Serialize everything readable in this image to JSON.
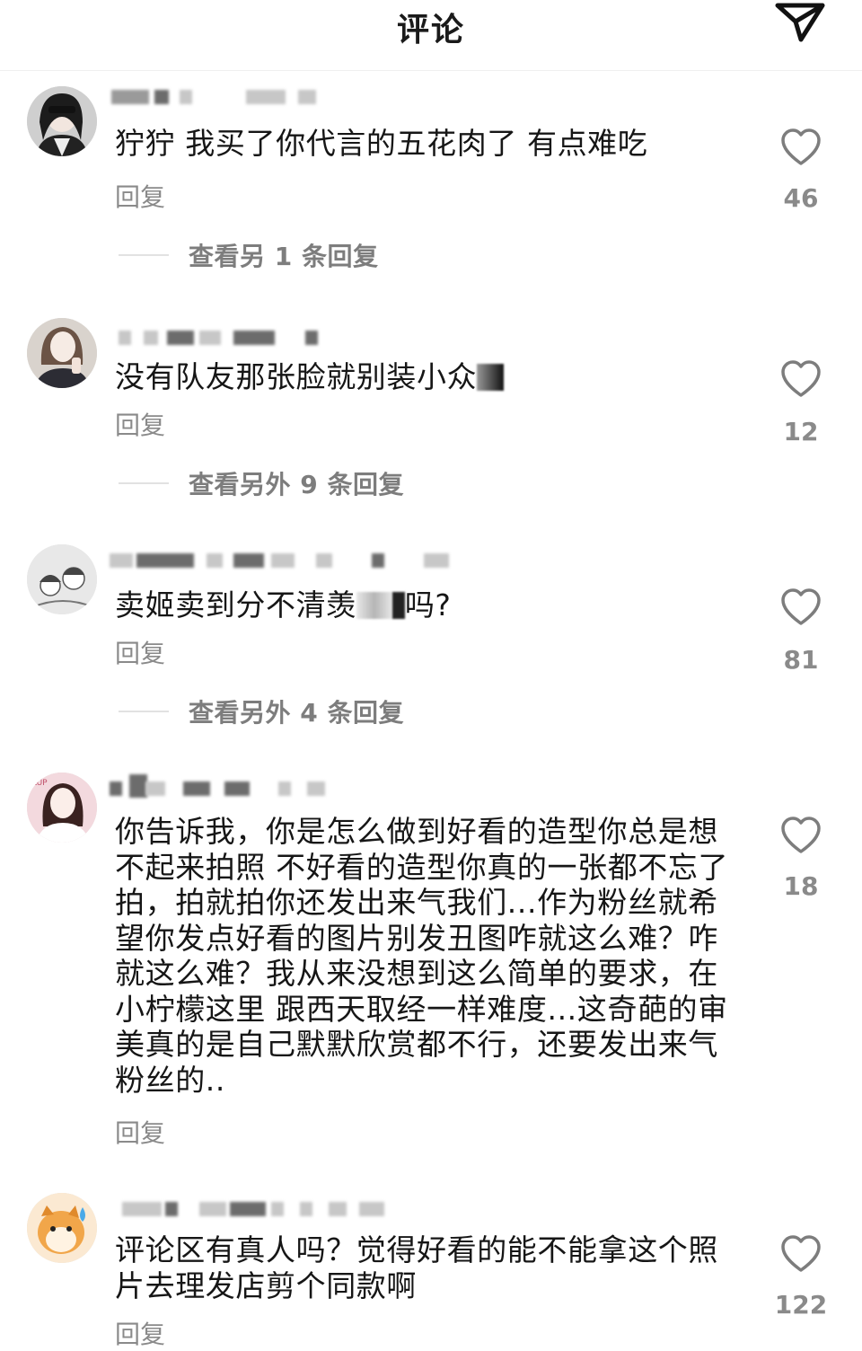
{
  "header": {
    "title": "评论"
  },
  "comments": [
    {
      "text_lines": [
        "狞狞 我买了你代言的五花肉了 有点难吃"
      ],
      "reply_label": "回复",
      "like_count": "46",
      "more_replies": "查看另 1 条回复"
    },
    {
      "text_lines": [
        "没有队友那张脸就别装小众"
      ],
      "reply_label": "回复",
      "like_count": "12",
      "more_replies": "查看另外 9 条回复"
    },
    {
      "text_pre": "卖姬卖到分不清羡",
      "text_post": "吗?",
      "reply_label": "回复",
      "like_count": "81",
      "more_replies": "查看另外 4 条回复"
    },
    {
      "text_lines": [
        "你告诉我，你是怎么做到好看的造型你总是想",
        "不起来拍照 不好看的造型你真的一张都不忘了",
        "拍，拍就拍你还发出来气我们...作为粉丝就希",
        "望你发点好看的图片别发丑图咋就这么难？咋",
        "就这么难？我从来没想到这么简单的要求，在",
        "小柠檬这里 跟西天取经一样难度...这奇葩的审",
        "美真的是自己默默欣赏都不行，还要发出来气",
        "粉丝的.."
      ],
      "reply_label": "回复",
      "like_count": "18"
    },
    {
      "text_lines": [
        "评论区有真人吗？觉得好看的能不能拿这个照",
        "片去理发店剪个同款啊"
      ],
      "reply_label": "回复",
      "like_count": "122"
    }
  ],
  "icons": {
    "share": "share-paper-plane-icon",
    "like": "heart-outline-icon",
    "accent": "#8a8a8a"
  }
}
